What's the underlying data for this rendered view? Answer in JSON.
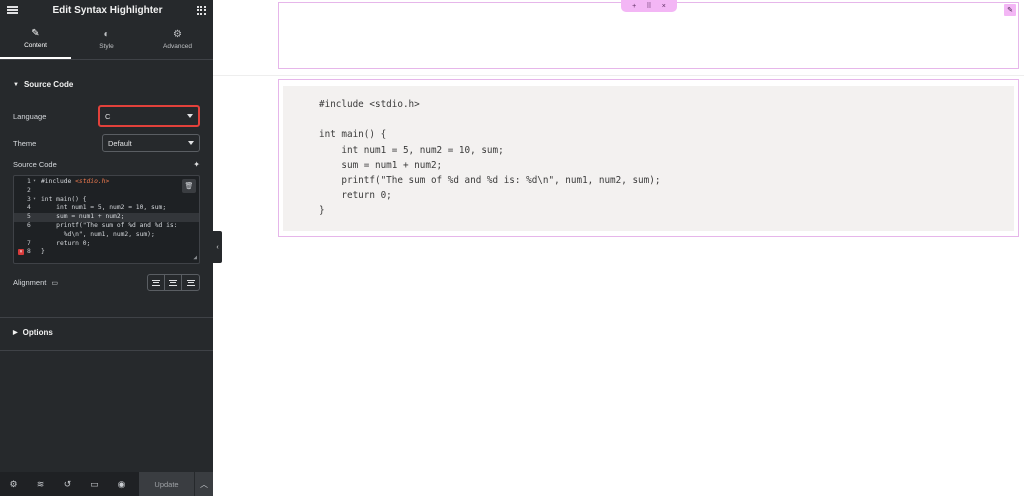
{
  "panel": {
    "title": "Edit Syntax Highlighter",
    "tabs": [
      {
        "label": "Content",
        "icon": "pencil-icon"
      },
      {
        "label": "Style",
        "icon": "contrast-icon"
      },
      {
        "label": "Advanced",
        "icon": "gear-icon"
      }
    ],
    "source_section_title": "Source Code",
    "language_label": "Language",
    "language_value": "C",
    "theme_label": "Theme",
    "theme_value": "Default",
    "source_code_label": "Source Code",
    "editor_lines": [
      {
        "num": "1",
        "text": "#include <stdio.h>"
      },
      {
        "num": "2",
        "text": ""
      },
      {
        "num": "3",
        "text": "int main() {"
      },
      {
        "num": "4",
        "text": "    int num1 = 5, num2 = 10, sum;"
      },
      {
        "num": "5",
        "text": "    sum = num1 + num2;"
      },
      {
        "num": "6",
        "text": "    printf(\"The sum of %d and %d is:"
      },
      {
        "num": "",
        "text": "      %d\\n\", num1, num2, sum);"
      },
      {
        "num": "7",
        "text": "    return 0;"
      },
      {
        "num": "8",
        "text": "}"
      }
    ],
    "alignment_label": "Alignment",
    "options_section_title": "Options",
    "update_label": "Update"
  },
  "canvas": {
    "code_lines": [
      "#include <stdio.h>",
      "",
      "int main() {",
      "    int num1 = 5, num2 = 10, sum;",
      "    sum = num1 + num2;",
      "    printf(\"The sum of %d and %d is: %d\\n\", num1, num2, sum);",
      "    return 0;",
      "}"
    ]
  },
  "colors": {
    "panel_bg": "#26292c",
    "accent_outline": "#e6b6ea",
    "error_outline": "#e2413b"
  }
}
